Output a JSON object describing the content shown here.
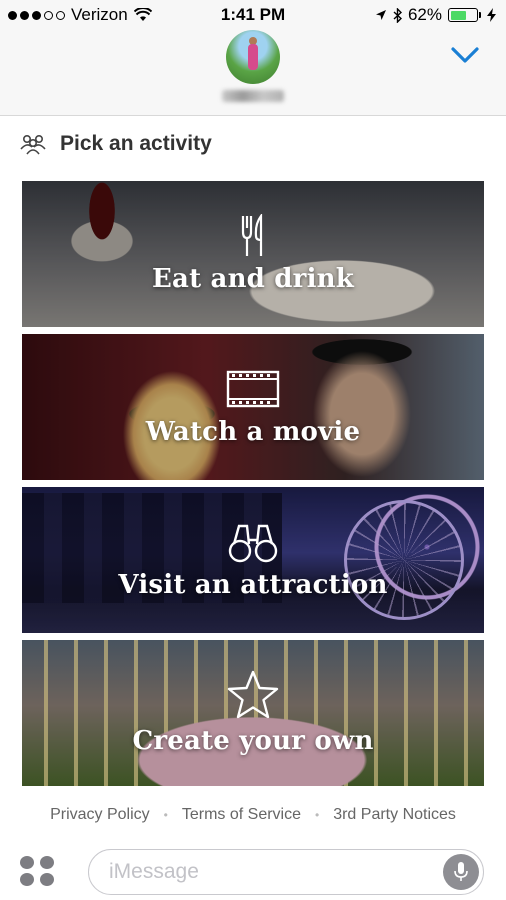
{
  "status_bar": {
    "carrier": "Verizon",
    "time": "1:41 PM",
    "battery": "62%",
    "battery_level": 0.62,
    "signal_bars_filled": 3,
    "signal_bars_total": 5
  },
  "header": {
    "contact_name": "",
    "collapse_icon": "chevron-down-icon"
  },
  "activity_picker": {
    "title": "Pick an activity",
    "icon": "people-icon",
    "tiles": [
      {
        "label": "Eat and drink",
        "icon": "fork-knife-icon"
      },
      {
        "label": "Watch a movie",
        "icon": "film-icon"
      },
      {
        "label": "Visit an attraction",
        "icon": "binoculars-icon"
      },
      {
        "label": "Create your own",
        "icon": "star-icon"
      }
    ]
  },
  "footer": {
    "links": [
      "Privacy Policy",
      "Terms of Service",
      "3rd Party Notices"
    ]
  },
  "compose": {
    "placeholder": "iMessage",
    "apps_icon": "app-drawer-icon",
    "mic_icon": "microphone-icon"
  },
  "colors": {
    "accent": "#1a7fd4",
    "battery_green": "#4cd964"
  }
}
